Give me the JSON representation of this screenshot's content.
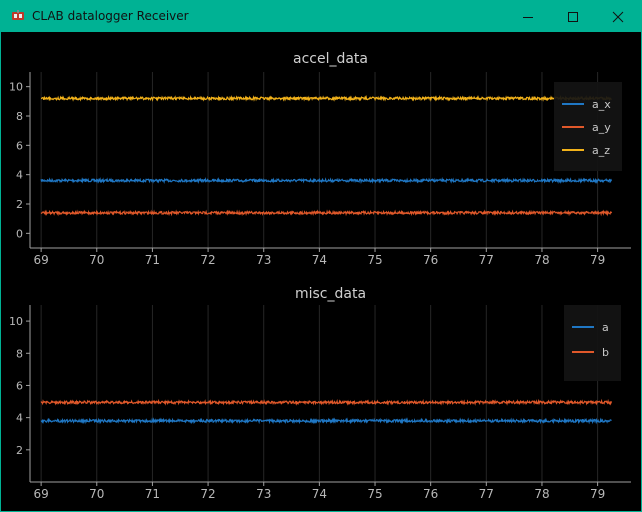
{
  "window": {
    "title": "CLAB datalogger Receiver",
    "icon": "app-logo-icon",
    "controls": [
      "minimize",
      "maximize",
      "close"
    ],
    "accent_color": "#00b294"
  },
  "chart_data": [
    {
      "type": "line",
      "title": "accel_data",
      "xlabel": "",
      "ylabel": "",
      "xlim": [
        68.8,
        79.6
      ],
      "ylim": [
        -1.0,
        11.0
      ],
      "xticks": [
        69,
        70,
        71,
        72,
        73,
        74,
        75,
        76,
        77,
        78,
        79
      ],
      "yticks": [
        0,
        2,
        4,
        6,
        8,
        10
      ],
      "grid": true,
      "legend_position": "top-right",
      "background": "#000000",
      "series": [
        {
          "name": "a_x",
          "color": "#1f77c4",
          "x": [
            69,
            79.25
          ],
          "y": [
            3.6,
            3.6
          ],
          "noise": 0.05
        },
        {
          "name": "a_y",
          "color": "#e0582a",
          "x": [
            69,
            79.25
          ],
          "y": [
            1.4,
            1.4
          ],
          "noise": 0.05
        },
        {
          "name": "a_z",
          "color": "#f2b21a",
          "x": [
            69,
            79.25
          ],
          "y": [
            9.2,
            9.2
          ],
          "noise": 0.05
        }
      ]
    },
    {
      "type": "line",
      "title": "misc_data",
      "xlabel": "",
      "ylabel": "",
      "xlim": [
        68.8,
        79.6
      ],
      "ylim": [
        0.0,
        11.0
      ],
      "xticks": [
        69,
        70,
        71,
        72,
        73,
        74,
        75,
        76,
        77,
        78,
        79
      ],
      "yticks": [
        2,
        4,
        6,
        8,
        10
      ],
      "grid": true,
      "legend_position": "top-right",
      "background": "#000000",
      "series": [
        {
          "name": "a",
          "color": "#1f77c4",
          "x": [
            69,
            79.25
          ],
          "y": [
            3.8,
            3.8
          ],
          "noise": 0.05
        },
        {
          "name": "b",
          "color": "#e0582a",
          "x": [
            69,
            79.25
          ],
          "y": [
            4.95,
            4.95
          ],
          "noise": 0.05
        }
      ]
    }
  ]
}
